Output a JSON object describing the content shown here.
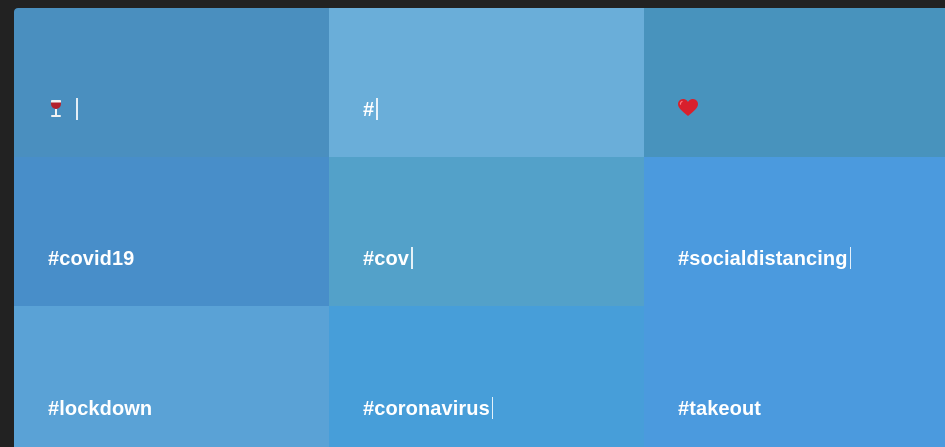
{
  "tiles": [
    {
      "name": "wine-emoji",
      "text": "",
      "icon": "wine-glass-icon",
      "color": "#4a8fbf",
      "caret": true
    },
    {
      "name": "hash",
      "text": "#",
      "icon": "",
      "color": "#6aaed9",
      "caret": true
    },
    {
      "name": "heart-emoji",
      "text": "",
      "icon": "red-heart-icon",
      "color": "#4893bd",
      "caret": false
    },
    {
      "name": "covid19",
      "text": "#covid19",
      "icon": "",
      "color": "#488ec9",
      "caret": false
    },
    {
      "name": "cov",
      "text": "#cov",
      "icon": "",
      "color": "#53a1c9",
      "caret": true
    },
    {
      "name": "socialdistancing",
      "text": "#socialdistancing",
      "icon": "",
      "color": "#4b9ade",
      "caret": true
    },
    {
      "name": "lockdown",
      "text": "#lockdown",
      "icon": "",
      "color": "#5aa2d6",
      "caret": false
    },
    {
      "name": "coronavirus",
      "text": "#coronavirus",
      "icon": "",
      "color": "#479ed9",
      "caret": true
    },
    {
      "name": "takeout",
      "text": "#takeout",
      "icon": "",
      "color": "#4b9ade",
      "caret": false
    }
  ],
  "background_color": "#222222"
}
